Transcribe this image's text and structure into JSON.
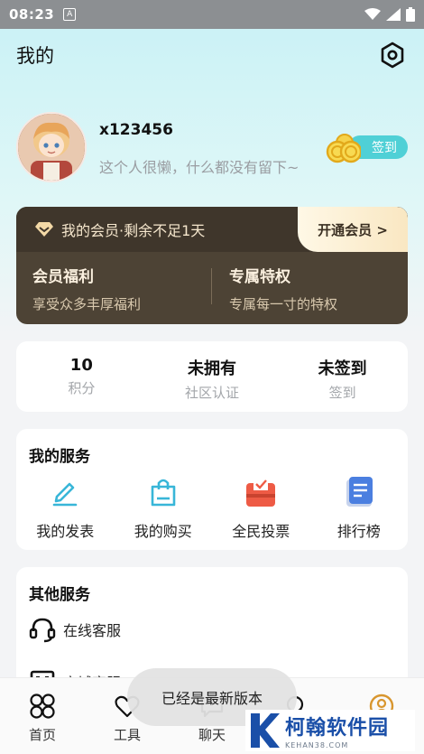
{
  "status_bar": {
    "time": "08:23",
    "notification_badge": "A"
  },
  "header": {
    "title": "我的"
  },
  "profile": {
    "username": "x123456",
    "bio": "这个人很懒，什么都没有留下~",
    "signin_label": "签到"
  },
  "vip": {
    "status": "我的会员·剩余不足1天",
    "open_label": "开通会员 >",
    "benefits_title": "会员福利",
    "benefits_desc": "享受众多丰厚福利",
    "privilege_title": "专属特权",
    "privilege_desc": "专属每一寸的特权"
  },
  "stats": [
    {
      "value": "10",
      "label": "积分"
    },
    {
      "value": "未拥有",
      "label": "社区认证"
    },
    {
      "value": "未签到",
      "label": "签到"
    }
  ],
  "my_services": {
    "title": "我的服务",
    "items": [
      {
        "label": "我的发表",
        "icon": "pencil-icon"
      },
      {
        "label": "我的购买",
        "icon": "shopping-bag-icon"
      },
      {
        "label": "全民投票",
        "icon": "vote-box-icon"
      },
      {
        "label": "排行榜",
        "icon": "document-list-icon"
      }
    ]
  },
  "other_services": {
    "title": "其他服务",
    "items": [
      {
        "label": "在线客服",
        "icon": "headset-icon"
      },
      {
        "label": "商城客服",
        "icon": "monitor-icon"
      }
    ]
  },
  "bottom_nav": [
    {
      "label": "首页",
      "icon": "home-grid-icon"
    },
    {
      "label": "工具",
      "icon": "heart-tool-icon"
    },
    {
      "label": "聊天",
      "icon": "chat-bubble-icon"
    },
    {
      "label": "",
      "icon": "community-icon"
    },
    {
      "label": "",
      "icon": "user-profile-icon"
    }
  ],
  "toast": "已经是最新版本",
  "watermark": {
    "name": "柯翰软件园",
    "domain": "KEHAN38.COM"
  },
  "colors": {
    "accent": "#4fd0d6",
    "vip_bg": "#4d4335",
    "vip_text": "#f3e4cb",
    "background": "#f3f4f6"
  }
}
